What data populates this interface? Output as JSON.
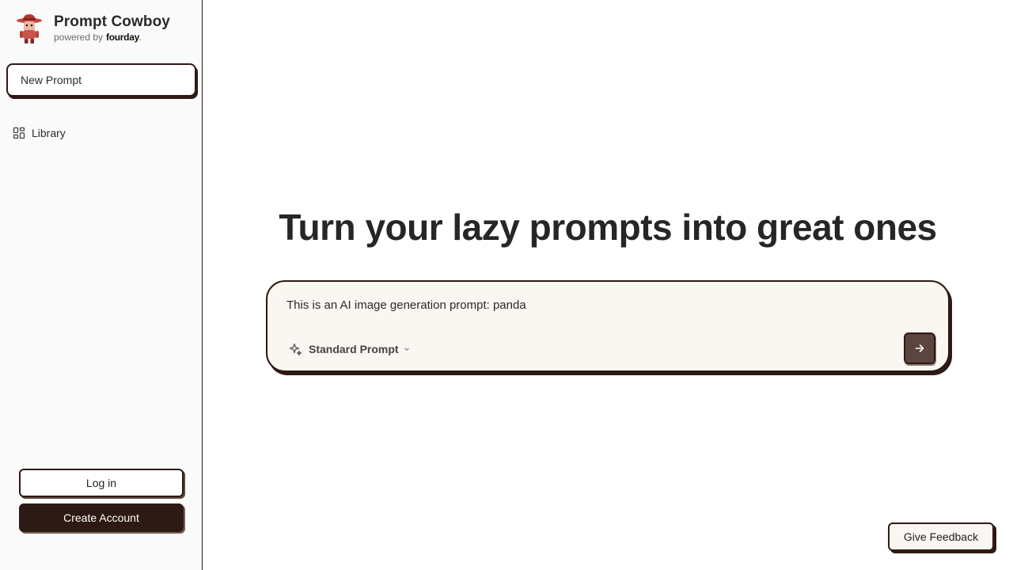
{
  "sidebar": {
    "brand": {
      "title": "Prompt Cowboy",
      "powered_by": "powered by",
      "partner_logo_text": "fourday",
      "logo_icon": "cowboy-mascot-icon"
    },
    "new_prompt_label": "New Prompt",
    "nav": {
      "library": {
        "label": "Library",
        "icon": "grid-layout-icon"
      }
    },
    "login_label": "Log in",
    "create_account_label": "Create Account"
  },
  "main": {
    "headline": "Turn your lazy prompts into great ones",
    "prompt": {
      "value": "This is an AI image generation prompt: panda",
      "mode": {
        "label": "Standard Prompt",
        "icon": "sparkle-icon"
      },
      "send_icon": "arrow-right-icon"
    }
  },
  "feedback_label": "Give Feedback",
  "colors": {
    "brand_dark": "#2e1a14",
    "send_button": "#5a463f",
    "prompt_bg": "#faf6f1",
    "sidebar_bg": "#fafafa"
  }
}
